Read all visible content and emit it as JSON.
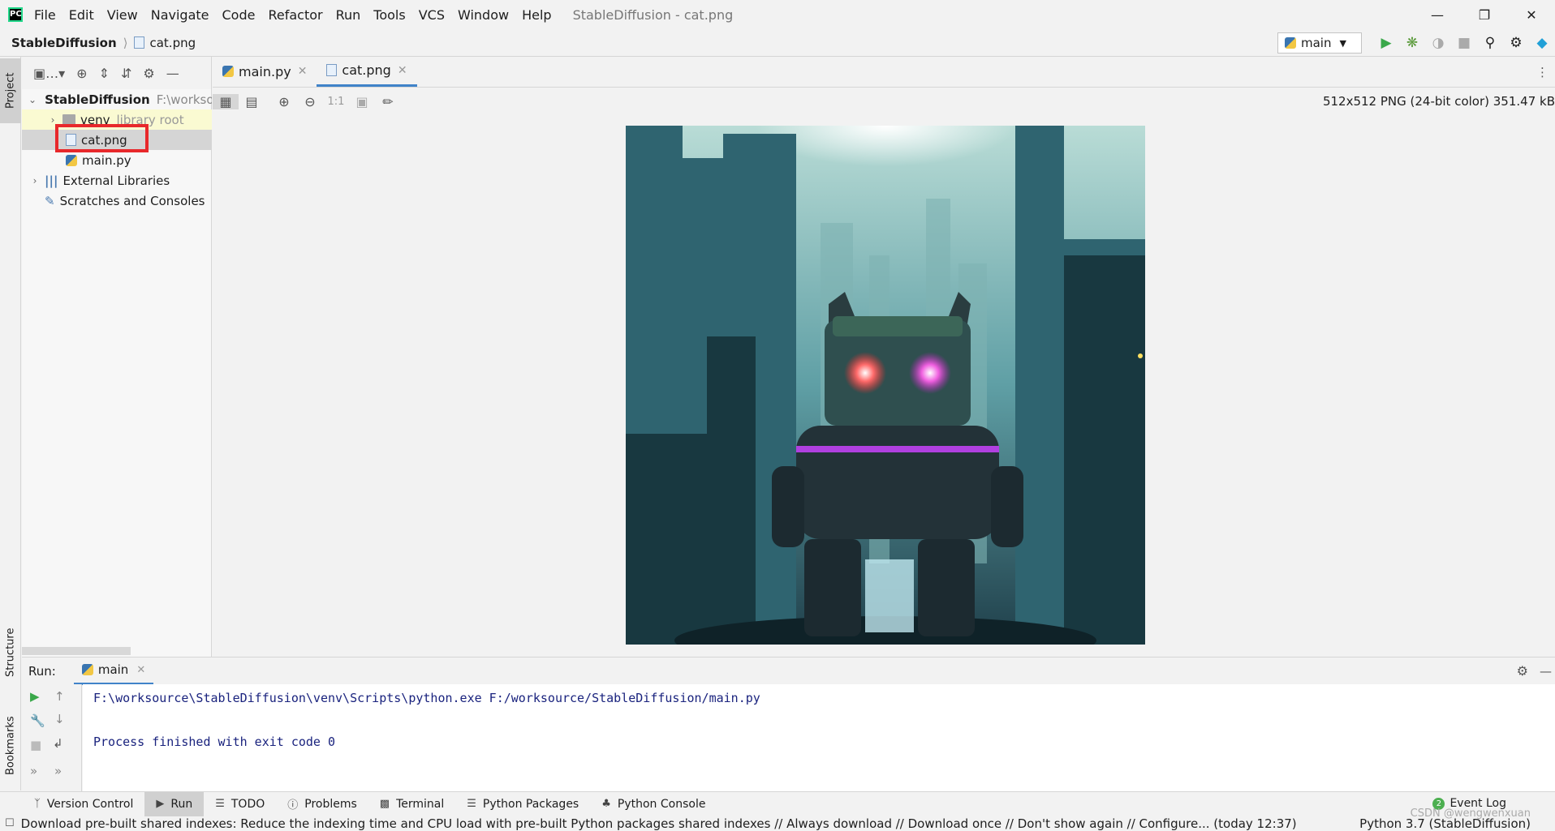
{
  "titlebar": {
    "logo": "PC",
    "menu": [
      "File",
      "Edit",
      "View",
      "Navigate",
      "Code",
      "Refactor",
      "Run",
      "Tools",
      "VCS",
      "Window",
      "Help"
    ],
    "title": "StableDiffusion - cat.png"
  },
  "navbar": {
    "project": "StableDiffusion",
    "file": "cat.png"
  },
  "run_config": "main",
  "left_tabs": {
    "project": "Project",
    "structure": "Structure",
    "bookmarks": "Bookmarks"
  },
  "tree": {
    "root": "StableDiffusion",
    "root_path": "F:\\worksource\\StableDiffusion",
    "venv": "venv",
    "venv_note": "library root",
    "file1": "cat.png",
    "file2": "main.py",
    "ext_libs": "External Libraries",
    "scratches": "Scratches and Consoles"
  },
  "editor_tabs": [
    "main.py",
    "cat.png"
  ],
  "image_info": "512x512 PNG (24-bit color) 351.47 kB",
  "image_tools": {
    "one_to_one": "1:1"
  },
  "run_panel": {
    "label": "Run:",
    "tab": "main"
  },
  "console": {
    "line1": "F:\\worksource\\StableDiffusion\\venv\\Scripts\\python.exe F:/worksource/StableDiffusion/main.py",
    "line2": "",
    "line3": "Process finished with exit code 0"
  },
  "bottom_tabs": [
    "Version Control",
    "Run",
    "TODO",
    "Problems",
    "Terminal",
    "Python Packages",
    "Python Console"
  ],
  "event_log": {
    "count": "2",
    "label": "Event Log"
  },
  "status": {
    "message": "Download pre-built shared indexes: Reduce the indexing time and CPU load with pre-built Python packages shared indexes // Always download // Download once // Don't show again // Configure... (today 12:37)",
    "interpreter": "Python 3.7 (StableDiffusion)"
  },
  "watermark": "CSDN @wengwenxuan",
  "colors": {
    "accent": "#4083c9",
    "highlight_box": "#e8282b",
    "console_text": "#1a237e"
  }
}
